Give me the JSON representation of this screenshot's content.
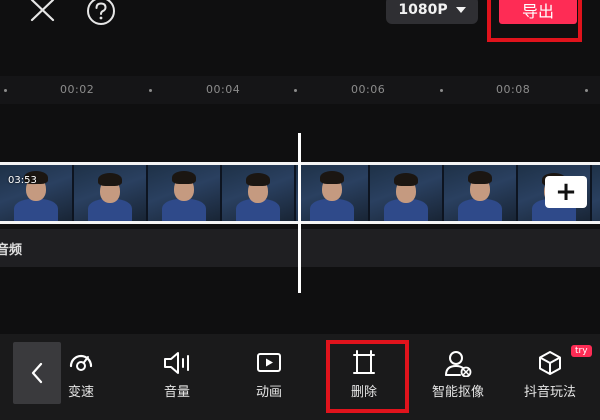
{
  "topbar": {
    "close_icon": "close-icon",
    "help_icon": "help-icon",
    "resolution": "1080P",
    "export_label": "导出"
  },
  "timeline": {
    "ruler_labels": [
      "00:02",
      "00:04",
      "00:06",
      "00:08"
    ],
    "clip_duration": "03:53",
    "add_icon": "plus-icon",
    "audio_track_label": "音频"
  },
  "toolbar": {
    "back_icon": "chevron-left-icon",
    "items": [
      {
        "label": "变速",
        "icon": "speed-icon"
      },
      {
        "label": "音量",
        "icon": "volume-icon"
      },
      {
        "label": "动画",
        "icon": "animation-icon"
      },
      {
        "label": "删除",
        "icon": "delete-icon"
      },
      {
        "label": "智能抠像",
        "icon": "smart-cutout-icon"
      },
      {
        "label": "抖音玩法",
        "icon": "cube-icon",
        "badge": "try"
      }
    ]
  },
  "colors": {
    "accent": "#fe2c55",
    "highlight": "#e0131c",
    "background": "#0f0f10"
  }
}
